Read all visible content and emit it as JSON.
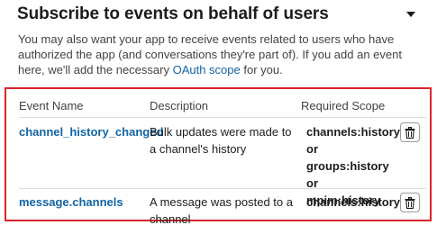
{
  "section": {
    "title": "Subscribe to events on behalf of users",
    "description_before": "You may also want your app to receive events related to users who have authorized the app (and conversations they're part of). If you add an event here, we'll add the necessary ",
    "description_link": "OAuth scope",
    "description_after": " for you."
  },
  "table": {
    "headers": {
      "name": "Event Name",
      "description": "Description",
      "scope": "Required Scope"
    },
    "rows": [
      {
        "name": "channel_history_changed",
        "description": "Bulk updates were made to a channel's history",
        "scopes": [
          "channels:history",
          "or",
          "groups:history",
          "or mpim:history"
        ]
      },
      {
        "name": "message.channels",
        "description": "A message was posted to a channel",
        "scopes": [
          "channels:history"
        ]
      }
    ]
  },
  "icons": {
    "collapse": "triangle-down-icon",
    "delete": "trash-icon"
  },
  "colors": {
    "link": "#1264a3",
    "highlight_border": "#d9232d"
  }
}
